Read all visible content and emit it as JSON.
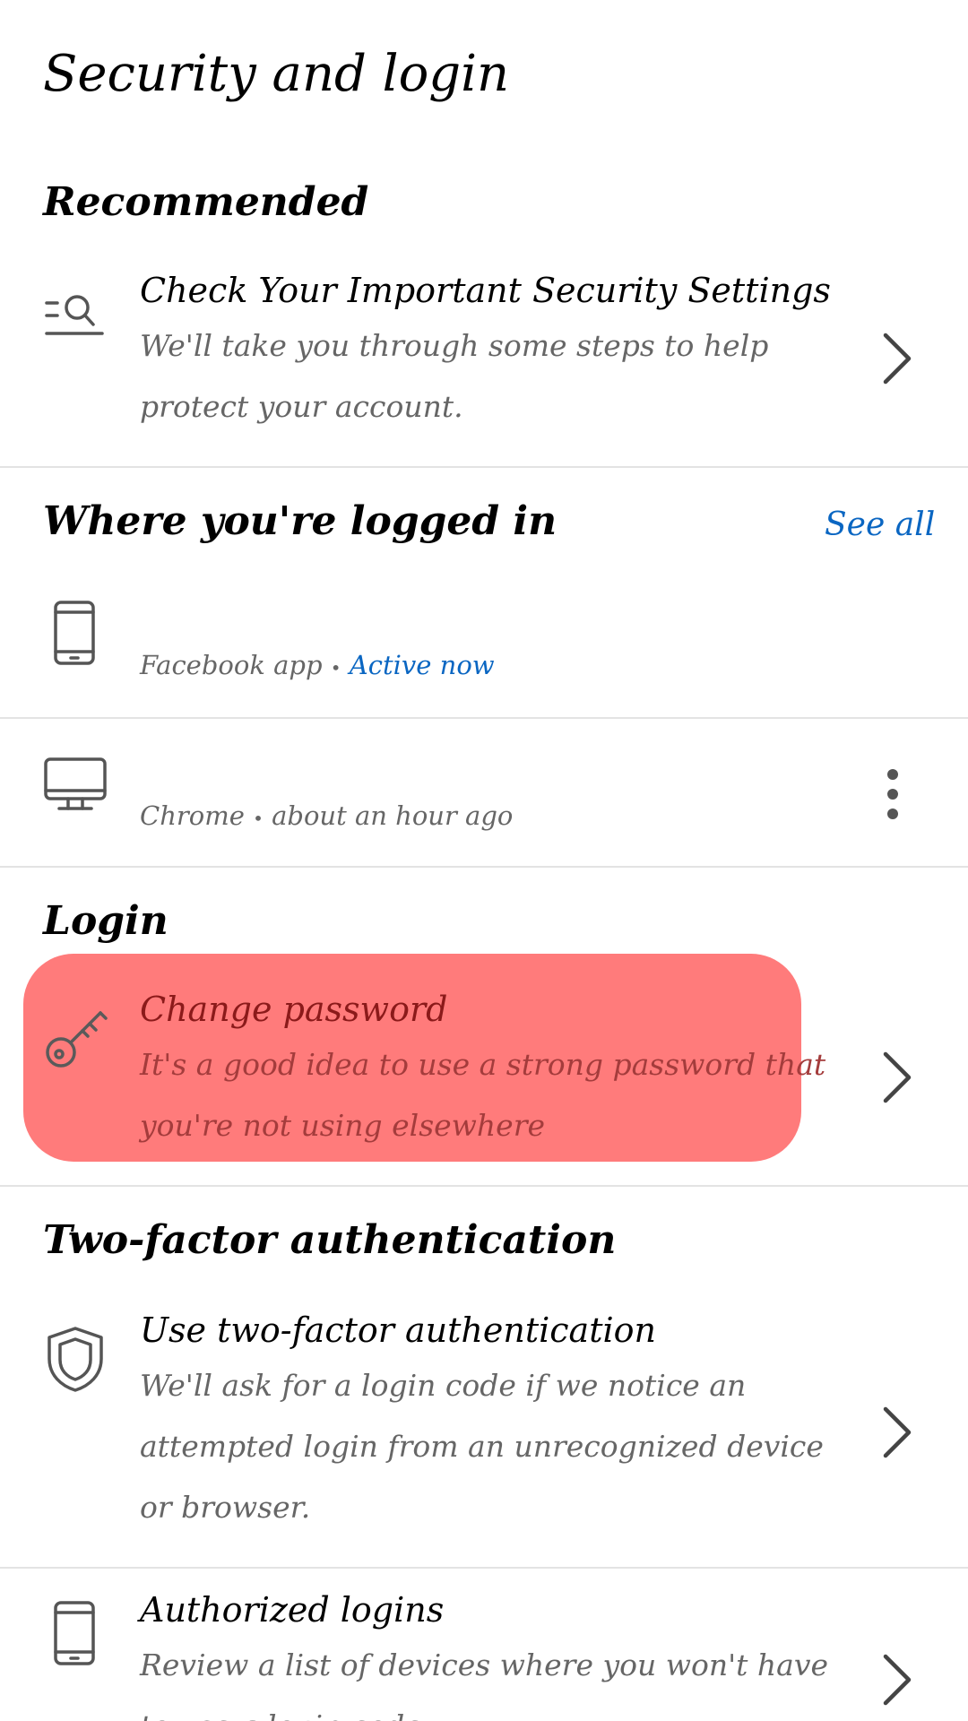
{
  "page": {
    "title": "Security and login"
  },
  "recommended": {
    "heading": "Recommended",
    "item": {
      "title": "Check Your Important Security Settings",
      "description": "We'll take you through some steps to help protect your account.",
      "icon": "search-list-icon"
    }
  },
  "logged_in": {
    "heading": "Where you're logged in",
    "see_all": "See all",
    "sessions": [
      {
        "device": "Facebook app",
        "separator": "•",
        "status": "Active now",
        "icon": "phone-icon"
      },
      {
        "device": "Chrome",
        "separator": "•",
        "status": "about an hour ago",
        "icon": "desktop-icon"
      }
    ]
  },
  "login": {
    "heading": "Login",
    "item": {
      "title": "Change password",
      "description": "It's a good idea to use a strong password that you're not using elsewhere",
      "icon": "key-icon"
    }
  },
  "two_factor": {
    "heading": "Two-factor authentication",
    "items": [
      {
        "title": "Use two-factor authentication",
        "description": "We'll ask for a login code if we notice an attempted login from an unrecognized device or browser.",
        "icon": "shield-icon"
      },
      {
        "title": "Authorized logins",
        "description": "Review a list of devices where you won't have to use a login code",
        "icon": "phone-icon"
      }
    ]
  },
  "colors": {
    "accent": "#0a66c2",
    "highlight": "#ff7b7b",
    "secondary_text": "#666666",
    "divider": "#e3e3e3"
  }
}
